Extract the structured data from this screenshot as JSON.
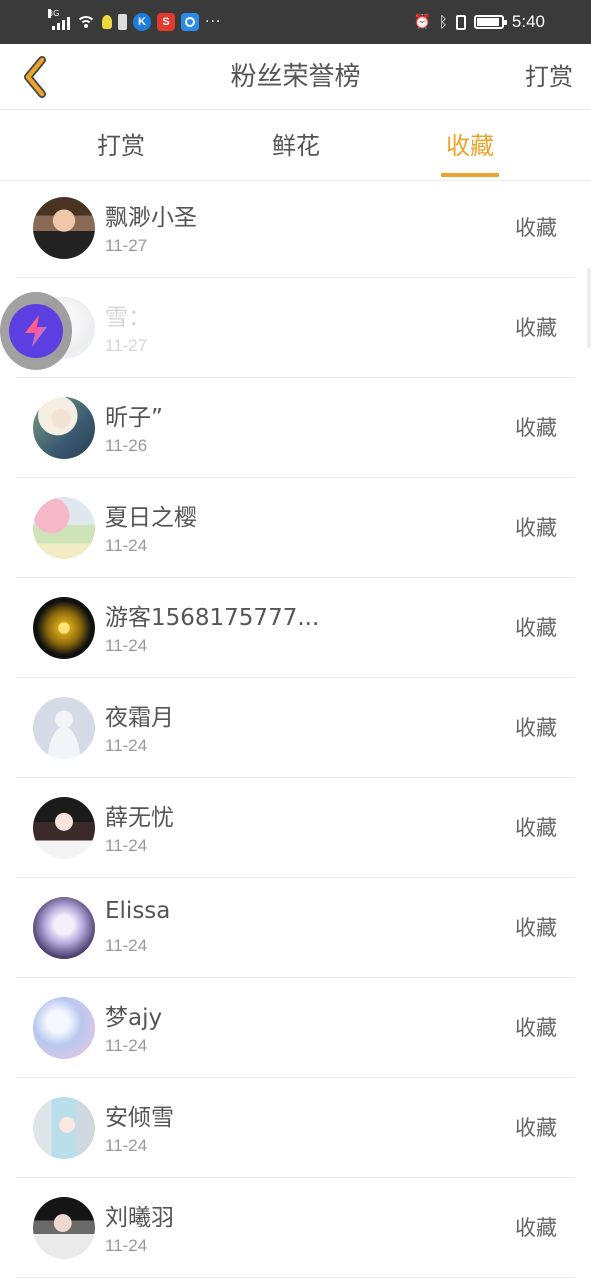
{
  "status_bar": {
    "network": "3G",
    "time": "5:40",
    "battery_level": 0.9,
    "icons": [
      "signal-icon",
      "wifi-icon",
      "bulb-icon",
      "battery-small-icon",
      "k-app-icon",
      "s-app-icon",
      "browser-app-icon",
      "more-dots-icon",
      "alarm-icon",
      "bluetooth-icon",
      "vibrate-icon",
      "battery-icon"
    ],
    "more_dots": "···"
  },
  "nav": {
    "title": "粉丝荣誉榜",
    "action": "打赏",
    "back_icon": "chevron-left-icon",
    "back_color": "#eaa42c"
  },
  "tabs": [
    {
      "label": "打赏",
      "active": false
    },
    {
      "label": "鲜花",
      "active": false
    },
    {
      "label": "收藏",
      "active": true
    }
  ],
  "accent_color": "#eaa42c",
  "list": [
    {
      "name": "飘渺小圣",
      "date": "11-27",
      "action": "收藏",
      "avatar": "photo-man-avatar"
    },
    {
      "name": "雪：",
      "date": "11-27",
      "action": "收藏",
      "avatar": "blurred-avatar"
    },
    {
      "name": "昕子”",
      "date": "11-26",
      "action": "收藏",
      "avatar": "photo-woman-avatar"
    },
    {
      "name": "夏日之樱",
      "date": "11-24",
      "action": "收藏",
      "avatar": "sakura-painting-avatar"
    },
    {
      "name": "游客1568175777...",
      "date": "11-24",
      "action": "收藏",
      "avatar": "sun-burst-avatar"
    },
    {
      "name": "夜霜月",
      "date": "11-24",
      "action": "收藏",
      "avatar": "default-user-avatar"
    },
    {
      "name": "薛无忧",
      "date": "11-24",
      "action": "收藏",
      "avatar": "photo-girl-avatar"
    },
    {
      "name": "Elissa",
      "date": "11-24",
      "action": "收藏",
      "avatar": "anime-girl-avatar"
    },
    {
      "name": "梦ajy",
      "date": "11-24",
      "action": "收藏",
      "avatar": "blue-anime-avatar"
    },
    {
      "name": "安倾雪",
      "date": "11-24",
      "action": "收藏",
      "avatar": "white-hair-anime-avatar"
    },
    {
      "name": "刘曦羽",
      "date": "11-24",
      "action": "收藏",
      "avatar": "photo-boy-avatar"
    }
  ],
  "floating_button": {
    "icon": "lightning-bolt-icon"
  }
}
